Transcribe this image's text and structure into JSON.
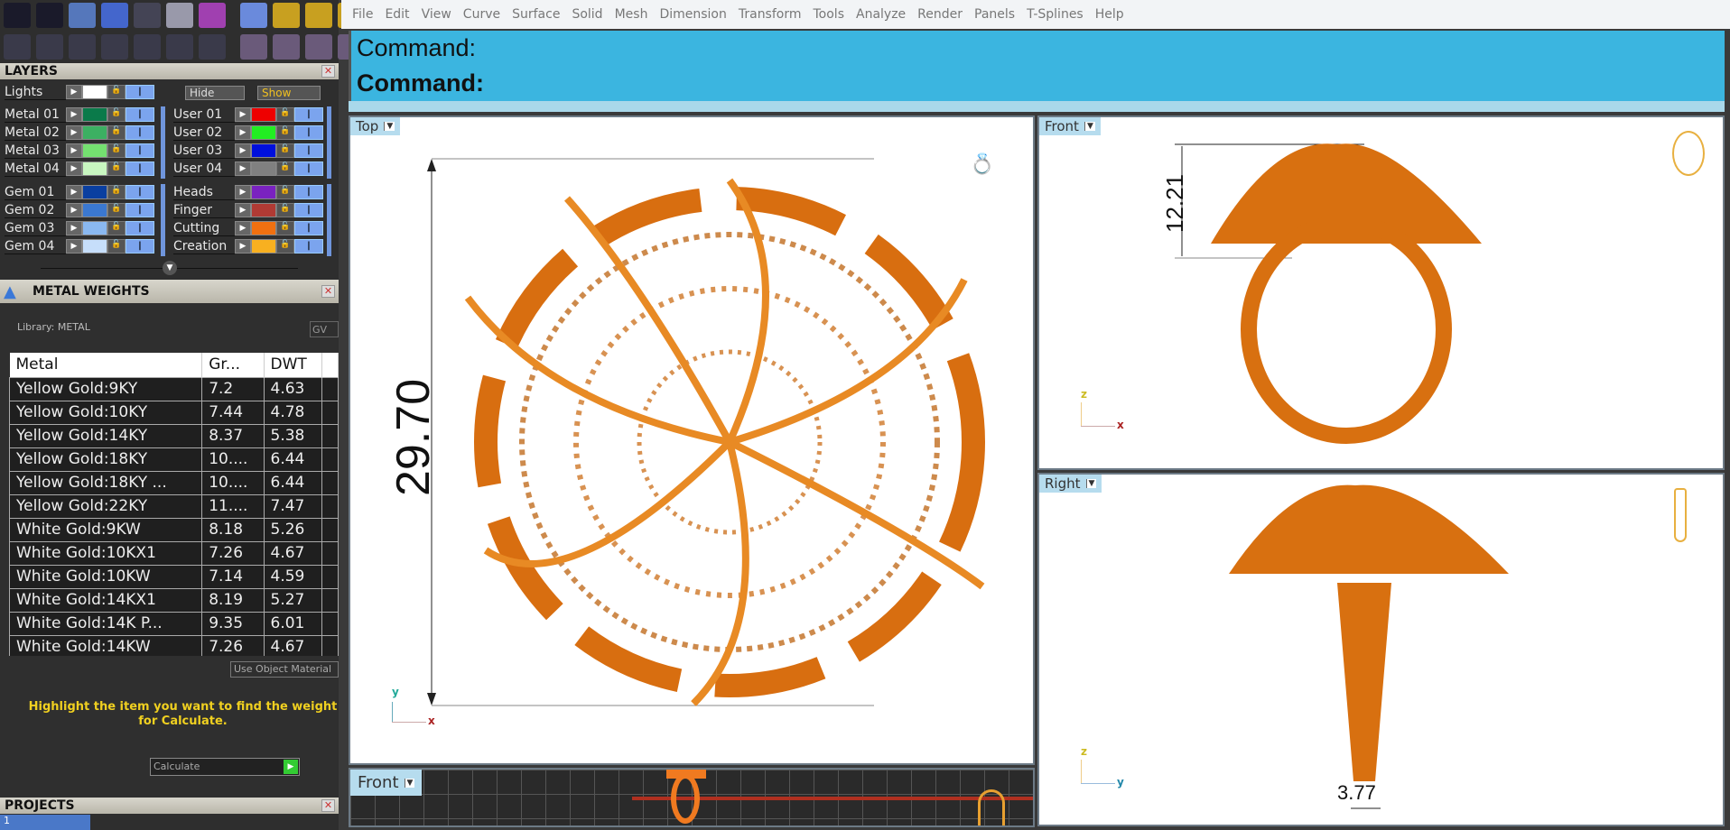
{
  "toolbar": {
    "row1": [
      "settings-icon",
      "wrench-icon",
      "layers-stack-icon",
      "box-icon",
      "document-icon",
      "edit-icon",
      "gem-box-icon",
      "lamp-icon",
      "import-icon",
      "export-icon",
      "delete-icon"
    ],
    "row2": [
      "viewports-icon",
      "monitor-icon",
      "cube-select-icon",
      "book-icon",
      "filter-icon",
      "select-points-icon",
      "report-icon",
      "gumball-icon",
      "gumball-scale-icon",
      "gumball-move-icon",
      "gumball-active-icon"
    ]
  },
  "layers": {
    "title": "LAYERS",
    "lights": {
      "label": "Lights",
      "color": "#ffffff"
    },
    "hide": "Hide",
    "show": "Show",
    "left": [
      {
        "label": "Metal 01",
        "color": "#0a7a4a"
      },
      {
        "label": "Metal 02",
        "color": "#3cb062"
      },
      {
        "label": "Metal 03",
        "color": "#74e070"
      },
      {
        "label": "Metal 04",
        "color": "#c8f6c0"
      },
      {
        "label": "Gem 01",
        "color": "#0a3fa0"
      },
      {
        "label": "Gem 02",
        "color": "#3b78d0"
      },
      {
        "label": "Gem 03",
        "color": "#8ab8f0"
      },
      {
        "label": "Gem 04",
        "color": "#c6defa"
      }
    ],
    "right": [
      {
        "label": "User 01",
        "color": "#ee0000"
      },
      {
        "label": "User 02",
        "color": "#22ee22"
      },
      {
        "label": "User 03",
        "color": "#0010dd"
      },
      {
        "label": "User 04",
        "color": "#808080"
      },
      {
        "label": "Heads",
        "color": "#7a22c0"
      },
      {
        "label": "Finger",
        "color": "#b03a34"
      },
      {
        "label": "Cutting",
        "color": "#f07010"
      },
      {
        "label": "Creation",
        "color": "#f8b020"
      }
    ]
  },
  "metal_weights": {
    "title": "METAL WEIGHTS",
    "library": "Library: METAL",
    "gv": "GV",
    "columns": [
      "Metal",
      "Gr...",
      "DWT"
    ],
    "rows": [
      [
        "Yellow Gold:9KY",
        "7.2",
        "4.63"
      ],
      [
        "Yellow Gold:10KY",
        "7.44",
        "4.78"
      ],
      [
        "Yellow Gold:14KY",
        "8.37",
        "5.38"
      ],
      [
        "Yellow Gold:18KY",
        "10....",
        "6.44"
      ],
      [
        "Yellow Gold:18KY ...",
        "10....",
        "6.44"
      ],
      [
        "Yellow Gold:22KY",
        "11....",
        "7.47"
      ],
      [
        "White Gold:9KW",
        "8.18",
        "5.26"
      ],
      [
        "White Gold:10KX1",
        "7.26",
        "4.67"
      ],
      [
        "White Gold:10KW",
        "7.14",
        "4.59"
      ],
      [
        "White Gold:14KX1",
        "8.19",
        "5.27"
      ],
      [
        "White Gold:14K P...",
        "9.35",
        "6.01"
      ],
      [
        "White Gold:14KW",
        "7.26",
        "4.67"
      ]
    ],
    "use_object_material": "Use Object Material",
    "hint": "Highlight the item you want to find the weight for Calculate.",
    "calculate": "Calculate"
  },
  "projects": {
    "title": "PROJECTS",
    "item": "1"
  },
  "menu": [
    "File",
    "Edit",
    "View",
    "Curve",
    "Surface",
    "Solid",
    "Mesh",
    "Dimension",
    "Transform",
    "Tools",
    "Analyze",
    "Render",
    "Panels",
    "T-Splines",
    "Help"
  ],
  "command": {
    "line1": "Command:",
    "line2": "Command:"
  },
  "viewports": {
    "top": {
      "label": "Top",
      "dimension": "29.70",
      "ax1": "y",
      "ax2": "x"
    },
    "front": {
      "label": "Front",
      "dimension": "12.21",
      "ax1": "z",
      "ax2": "x"
    },
    "right": {
      "label": "Right",
      "dimension": "3.77",
      "ax1": "z",
      "ax2": "y"
    },
    "front_small": {
      "label": "Front"
    }
  },
  "colors": {
    "metal": "#e07a14",
    "command_bg": "#3bb5e0"
  }
}
